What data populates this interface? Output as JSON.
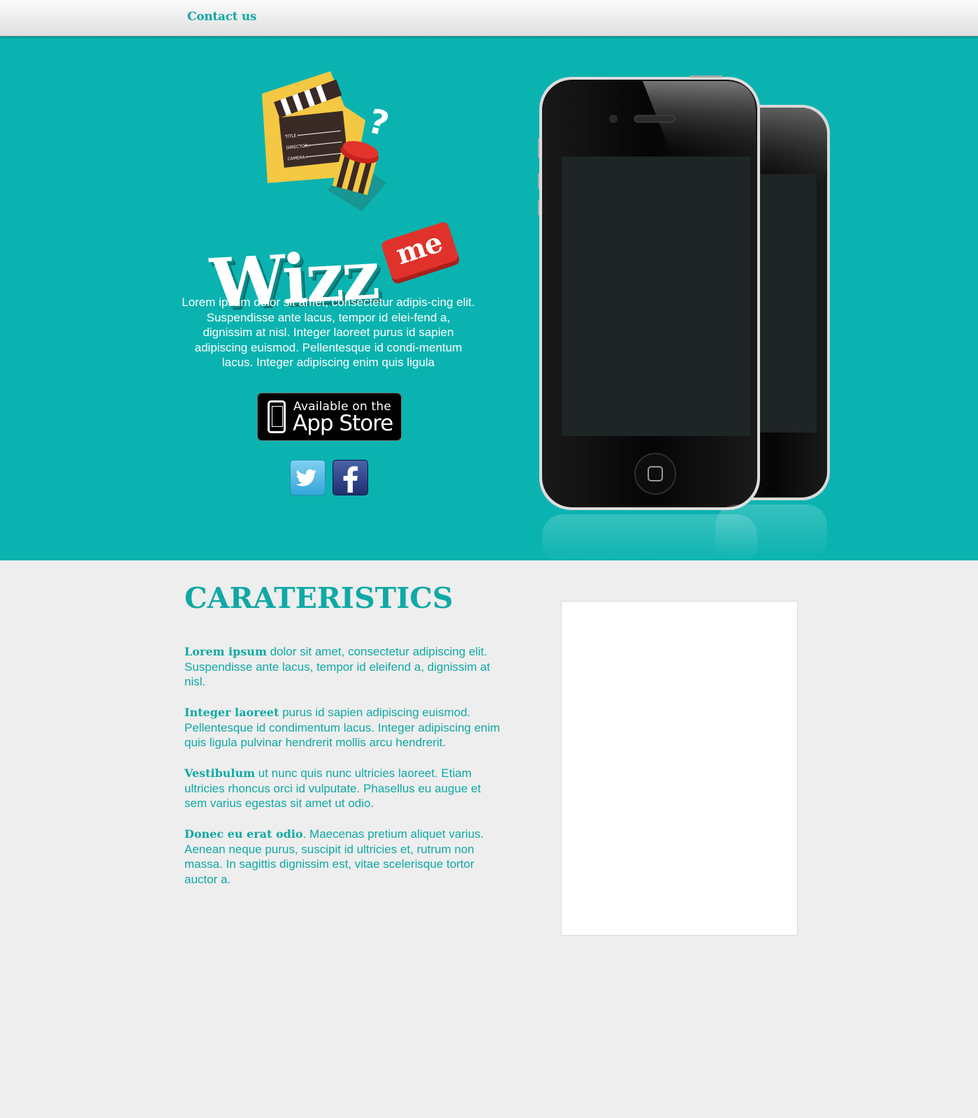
{
  "nav": {
    "contact_label": "Contact us"
  },
  "hero": {
    "logo_word": "Wizz",
    "logo_badge": "me",
    "clapper_labels": [
      "TITLE :",
      "DIRECTOR :",
      "CAMERA :"
    ],
    "logo_question_mark": "?",
    "description": "Lorem ipsum dolor sit amet, consectetur adipis-cing elit. Suspendisse ante lacus, tempor id elei-fend a, dignissim at nisl. Integer laoreet purus id sapien adipiscing euismod. Pellentesque id condi-mentum lacus. Integer adipiscing enim quis ligula",
    "appstore": {
      "line1": "Available on the",
      "line2": "App Store"
    },
    "social": [
      {
        "icon": "twitter-icon"
      },
      {
        "icon": "facebook-icon"
      }
    ]
  },
  "features": {
    "title": "CARATERISTICS",
    "items": [
      {
        "bold": "Lorem ipsum",
        "text": " dolor sit amet, consectetur adipiscing elit. Suspendisse ante lacus, tempor id eleifend a, dignissim at nisl."
      },
      {
        "bold": "Integer laoreet",
        "text": " purus id sapien adipiscing euismod. Pellentesque id condimentum lacus. Integer adipiscing enim quis ligula pulvinar hendrerit mollis arcu hendrerit."
      },
      {
        "bold": "Vestibulum",
        "text": " ut nunc quis nunc ultricies laoreet. Etiam ultricies rhoncus orci id vulputate. Phasellus eu augue et sem varius egestas sit amet ut odio."
      },
      {
        "bold": "Donec eu erat odio",
        "text": ". Maecenas pretium aliquet varius. Aenean neque purus, suscipit id ultricies et, rutrum non massa. In sagittis dignissim est, vitae scelerisque tortor auctor a."
      }
    ]
  },
  "colors": {
    "teal": "#0ab3b0",
    "teal_text": "#0fa9a5",
    "background": "#eeeeee",
    "badge_red": "#e0322b"
  }
}
